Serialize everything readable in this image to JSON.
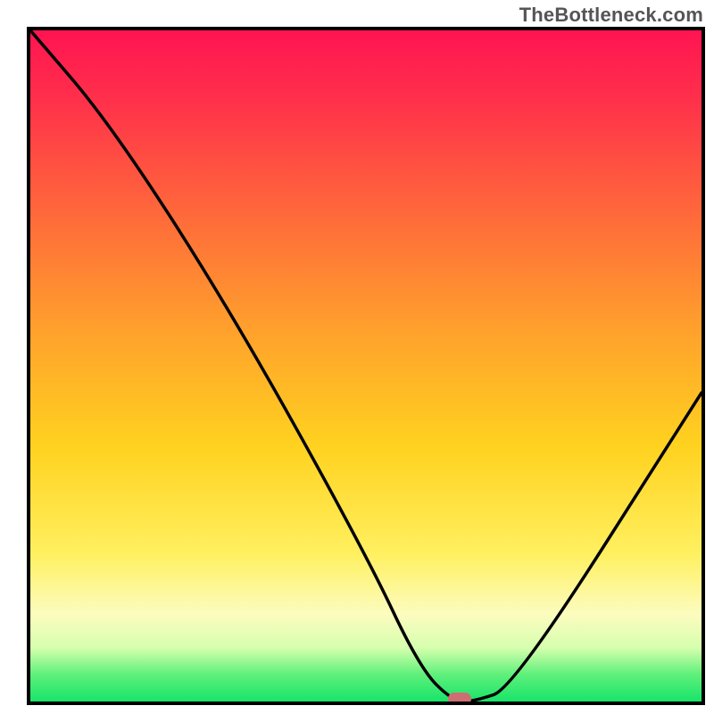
{
  "watermark": "TheBottleneck.com",
  "chart_data": {
    "type": "line",
    "title": "",
    "xlabel": "",
    "ylabel": "",
    "xlim": [
      0,
      100
    ],
    "ylim": [
      0,
      100
    ],
    "grid": false,
    "series": [
      {
        "name": "bottleneck-curve",
        "x": [
          0,
          12,
          30,
          50,
          58,
          63,
          66,
          72,
          100
        ],
        "values": [
          100,
          86,
          58,
          22,
          5,
          0,
          0,
          2,
          46
        ]
      }
    ],
    "marker": {
      "x": 64,
      "y": 0,
      "color": "#cf6e72"
    },
    "background_gradient": {
      "orientation": "vertical",
      "stops": [
        {
          "pos": 0,
          "color": "#ff1451"
        },
        {
          "pos": 0.28,
          "color": "#ff6b3a"
        },
        {
          "pos": 0.62,
          "color": "#ffd21f"
        },
        {
          "pos": 0.87,
          "color": "#fcfcbf"
        },
        {
          "pos": 1.0,
          "color": "#18e46a"
        }
      ]
    }
  }
}
